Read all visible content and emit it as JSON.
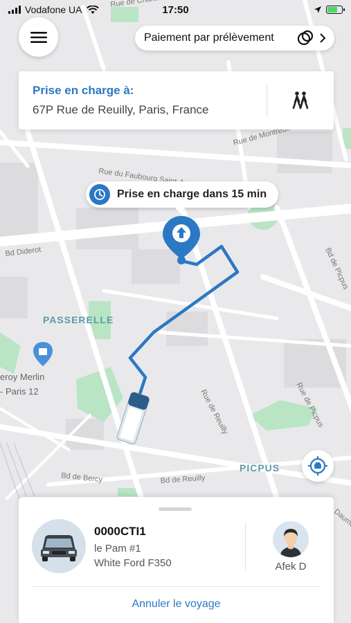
{
  "status_bar": {
    "carrier": "Vodafone UA",
    "time": "17:50",
    "battery_percent": 70
  },
  "header": {
    "menu_icon": "hamburger-icon",
    "payment_label": "Paiement par prélèvement"
  },
  "pickup": {
    "label": "Prise en charge à:",
    "address": "67P Rue de Reuilly, Paris, France",
    "walk_icon": "walking-people-icon"
  },
  "map": {
    "eta_text": "Prise en charge dans 15 min",
    "street_labels": [
      "Rue de Charonne",
      "Rue de Montreuil",
      "Rue du Faubourg Saint-Antoine",
      "Bd Diderot",
      "Bd de Picpus",
      "Rue de Reuilly",
      "Rue de Picpus",
      "Bd de Bercy",
      "Bd de Reuilly",
      "Daumesnil"
    ],
    "area_labels": [
      "PASSERELLE",
      "PICPUS"
    ],
    "poi_label_lines": [
      "eroy Merlin",
      "- Paris 12"
    ],
    "locate_icon": "locate-vehicle-icon",
    "colors": {
      "route": "#2b78c5",
      "park": "#b9e5c4",
      "road": "#ffffff",
      "land": "#e8e8ea"
    }
  },
  "trip": {
    "plate": "0000CTI1",
    "provider": "le Pam #1",
    "vehicle": "White Ford F350",
    "driver_name": "Afek D",
    "cancel_label": "Annuler le voyage"
  }
}
